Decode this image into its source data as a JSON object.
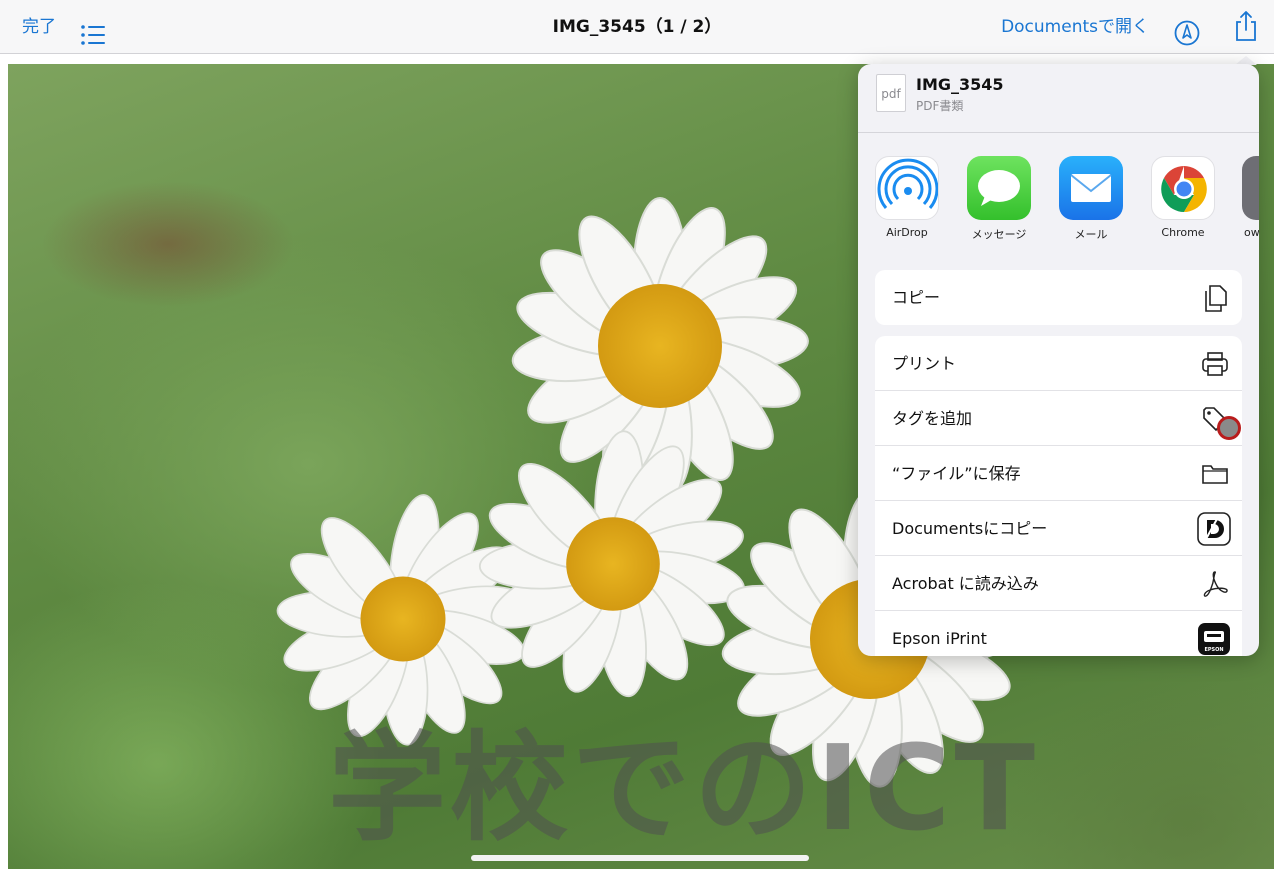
{
  "nav": {
    "done_label": "完了",
    "title": "IMG_3545（1 / 2）",
    "open_in_documents": "Documentsで開く",
    "accent": "#1a76d2"
  },
  "photo": {
    "watermark_text": "学校でのICT"
  },
  "share_sheet": {
    "file": {
      "icon_text": "pdf",
      "name": "IMG_3545",
      "type": "PDF書類"
    },
    "apps": [
      {
        "label": "AirDrop",
        "icon": "airdrop-icon"
      },
      {
        "label": "メッセージ",
        "icon": "messages-icon"
      },
      {
        "label": "メール",
        "icon": "mail-icon"
      },
      {
        "label": "Chrome",
        "icon": "chrome-icon"
      },
      {
        "label": "ow",
        "icon": "partial-app-icon"
      }
    ],
    "group1": [
      {
        "label": "コピー",
        "icon": "copy-icon"
      }
    ],
    "group2": [
      {
        "label": "プリント",
        "icon": "print-icon"
      },
      {
        "label": "タグを追加",
        "icon": "tag-icon"
      },
      {
        "label": "“ファイル”に保存",
        "icon": "folder-icon"
      },
      {
        "label": "Documentsにコピー",
        "icon": "documents-app-icon"
      },
      {
        "label": "Acrobat に読み込み",
        "icon": "acrobat-icon"
      },
      {
        "label": "Epson iPrint",
        "icon": "epson-icon"
      }
    ],
    "epson_badge": "EPSON"
  }
}
